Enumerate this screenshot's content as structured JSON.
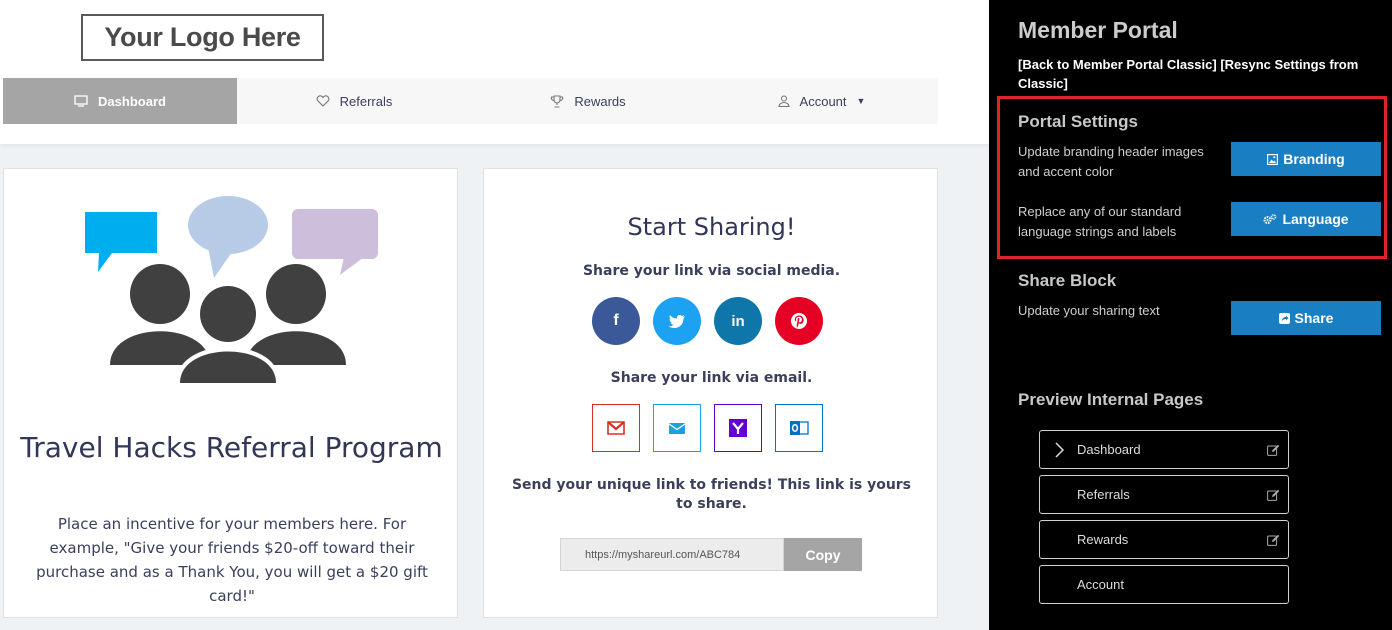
{
  "logo": {
    "text": "Your Logo Here"
  },
  "nav": {
    "items": [
      {
        "label": "Dashboard",
        "icon": "monitor-icon",
        "active": true
      },
      {
        "label": "Referrals",
        "icon": "heart-icon"
      },
      {
        "label": "Rewards",
        "icon": "trophy-icon"
      },
      {
        "label": "Account",
        "icon": "user-icon"
      }
    ]
  },
  "program": {
    "title": "Travel Hacks Referral Program",
    "description": "Place an incentive for your members here. For example, \"Give your friends $20-off toward their purchase and as a Thank You, you will get a $20 gift card!\""
  },
  "sharing": {
    "title": "Start Sharing!",
    "social_label": "Share your link via social media.",
    "email_label": "Share your link via email.",
    "social": [
      {
        "name": "facebook-icon",
        "glyph": "f",
        "color": "#3b5998"
      },
      {
        "name": "twitter-icon",
        "glyph": "t",
        "color": "#1da1f2"
      },
      {
        "name": "linkedin-icon",
        "glyph": "in",
        "color": "#0e76a8"
      },
      {
        "name": "pinterest-icon",
        "glyph": "p",
        "color": "#e60023"
      }
    ],
    "email": [
      {
        "name": "gmail-icon",
        "color": "#d93025"
      },
      {
        "name": "mail-icon",
        "color": "#1aa1e0"
      },
      {
        "name": "yahoo-icon",
        "color": "#6001d2"
      },
      {
        "name": "outlook-icon",
        "color": "#0072c6"
      }
    ],
    "send_text": "Send your unique link to friends! This link is yours to share.",
    "url": "https://myshareurl.com/ABC784",
    "copy_label": "Copy"
  },
  "sidebar": {
    "title": "Member Portal",
    "links": {
      "back": "[Back to Member Portal Classic]",
      "resync": "[Resync Settings from Classic]"
    },
    "portal_settings": {
      "title": "Portal Settings",
      "branding_desc": "Update branding header images and accent color",
      "branding_label": "Branding",
      "language_desc": "Replace any of our standard language strings and labels",
      "language_label": "Language"
    },
    "share_block": {
      "title": "Share Block",
      "desc": "Update your sharing text",
      "share_label": "Share"
    },
    "preview": {
      "title": "Preview Internal Pages",
      "pages": [
        {
          "label": "Dashboard",
          "editable": true,
          "current": true
        },
        {
          "label": "Referrals",
          "editable": true
        },
        {
          "label": "Rewards",
          "editable": true
        },
        {
          "label": "Account",
          "editable": false
        }
      ]
    }
  },
  "colors": {
    "accent_blue": "#1a7fc2",
    "highlight_red": "#e0242c",
    "nav_active": "#a5a5a5"
  }
}
